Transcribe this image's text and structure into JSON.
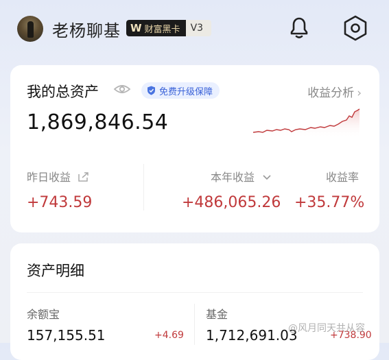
{
  "header": {
    "username": "老杨聊基",
    "vip_card": "财富黑卡",
    "vip_level": "V3",
    "icons": [
      "bell-icon",
      "settings-icon"
    ]
  },
  "assets": {
    "title": "我的总资产",
    "badge": "免费升级保障",
    "analysis_link": "收益分析",
    "total": "1,869,846.54",
    "yesterday_label": "昨日收益",
    "yesterday_value": "+743.59",
    "year_label": "本年收益",
    "year_value": "+486,065.26",
    "rate_label": "收益率",
    "rate_value": "+35.77%",
    "trend_color": "#c0393b"
  },
  "details": {
    "title": "资产明细",
    "items": [
      {
        "name": "余额宝",
        "amount": "157,155.51",
        "change": "+4.69"
      },
      {
        "name": "基金",
        "amount": "1,712,691.03",
        "change": "+738.90"
      }
    ]
  },
  "watermark": "@风月同天共从容"
}
